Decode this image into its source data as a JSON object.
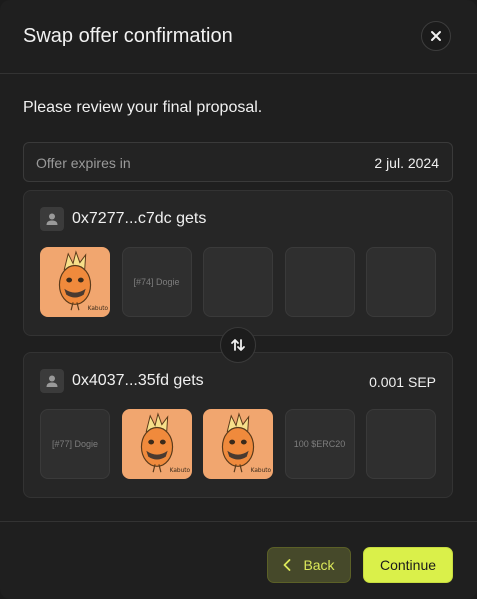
{
  "modal": {
    "title": "Swap offer confirmation",
    "close_icon": "close-icon"
  },
  "subtitle": "Please review your final proposal.",
  "expiry": {
    "label": "Offer expires in",
    "value": "2 jul. 2024"
  },
  "offer_1": {
    "user": "0x7277...c7dc gets",
    "items": [
      {
        "type": "nft-art",
        "label": ""
      },
      {
        "type": "placeholder",
        "label": "[#74] Dogie"
      },
      {
        "type": "empty",
        "label": ""
      },
      {
        "type": "empty",
        "label": ""
      },
      {
        "type": "empty",
        "label": ""
      }
    ]
  },
  "offer_2": {
    "user": "0x4037...35fd gets",
    "amount": "0.001 SEP",
    "items": [
      {
        "type": "placeholder",
        "label": "[#77] Dogie"
      },
      {
        "type": "nft-art",
        "label": ""
      },
      {
        "type": "nft-art",
        "label": ""
      },
      {
        "type": "placeholder",
        "label": "100 $ERC20"
      },
      {
        "type": "empty",
        "label": ""
      }
    ]
  },
  "swap_icon": "swap-arrows-icon",
  "actions": {
    "back_label": "Back",
    "continue_label": "Continue"
  },
  "colors": {
    "accent": "#daf04a",
    "background": "#1f1f1f",
    "panel": "#262626",
    "nft_art_bg": "#f1a66f"
  }
}
